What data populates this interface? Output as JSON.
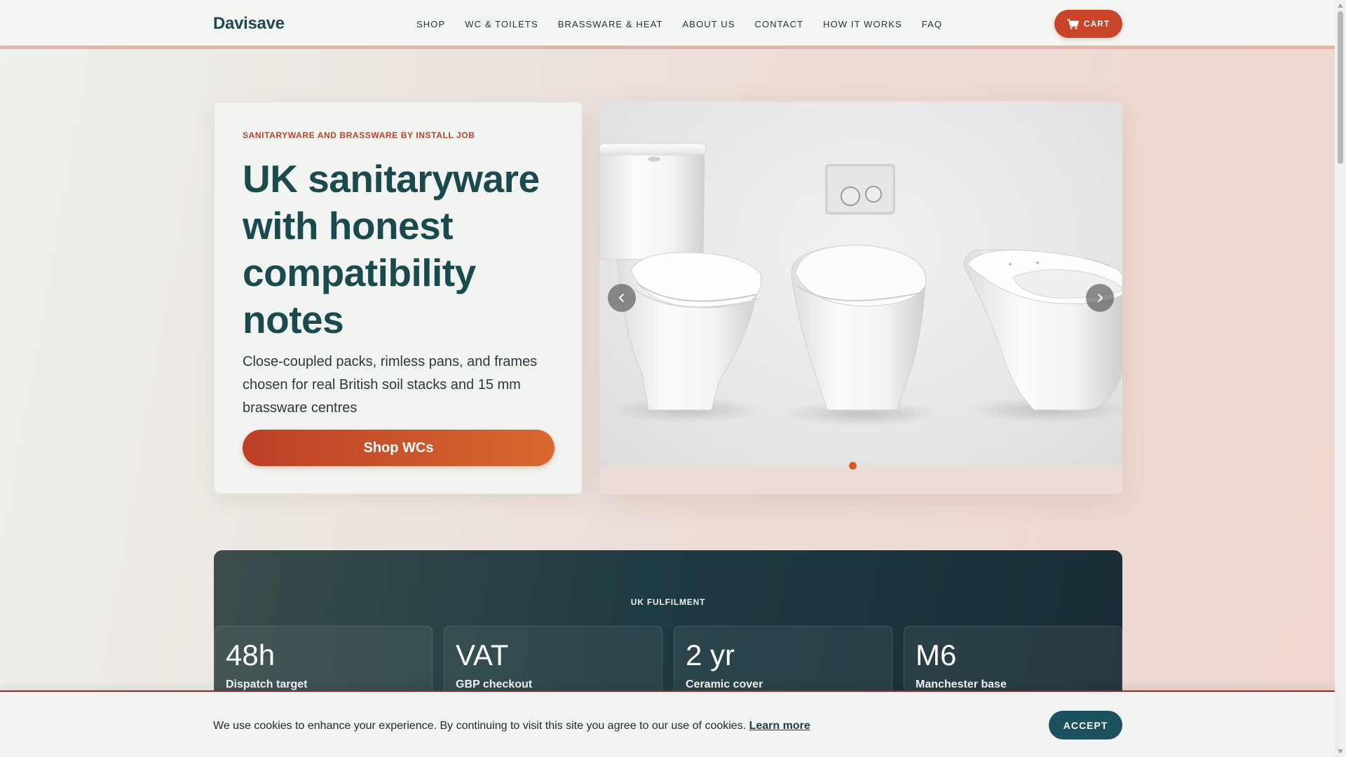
{
  "header": {
    "logo": "Davisave",
    "nav": [
      {
        "label": "SHOP"
      },
      {
        "label": "WC & TOILETS"
      },
      {
        "label": "BRASSWARE & HEAT"
      },
      {
        "label": "ABOUT US"
      },
      {
        "label": "CONTACT"
      },
      {
        "label": "HOW IT WORKS"
      },
      {
        "label": "FAQ"
      }
    ],
    "cart_label": "CART",
    "cart_icon": "cart-icon"
  },
  "hero": {
    "eyebrow": "SANITARYWARE AND BRASSWARE BY INSTALL JOB",
    "title": "UK sanitaryware with honest compatibility notes",
    "description": "Close-coupled packs, rimless pans, and frames chosen for real British soil stacks and 15 mm brassware centres",
    "cta_label": "Shop WCs"
  },
  "carousel": {
    "prev_icon": "chevron-left-icon",
    "next_icon": "chevron-right-icon",
    "slide_count": 2,
    "active_slide": 1
  },
  "fulfilment": {
    "label": "UK FULFILMENT",
    "stats": [
      {
        "value": "48h",
        "label": "Dispatch target"
      },
      {
        "value": "VAT",
        "label": "GBP checkout"
      },
      {
        "value": "2 yr",
        "label": "Ceramic cover"
      },
      {
        "value": "M6",
        "label": "Manchester base"
      }
    ]
  },
  "cookie": {
    "text": "We use cookies to enhance your experience. By continuing to visit this site you agree to our use of cookies.",
    "link_label": "Learn more",
    "accept_label": "ACCEPT"
  },
  "colors": {
    "brand": "#1d4a50",
    "accent": "#c8452a",
    "dark_panel": "#1f3c42"
  }
}
